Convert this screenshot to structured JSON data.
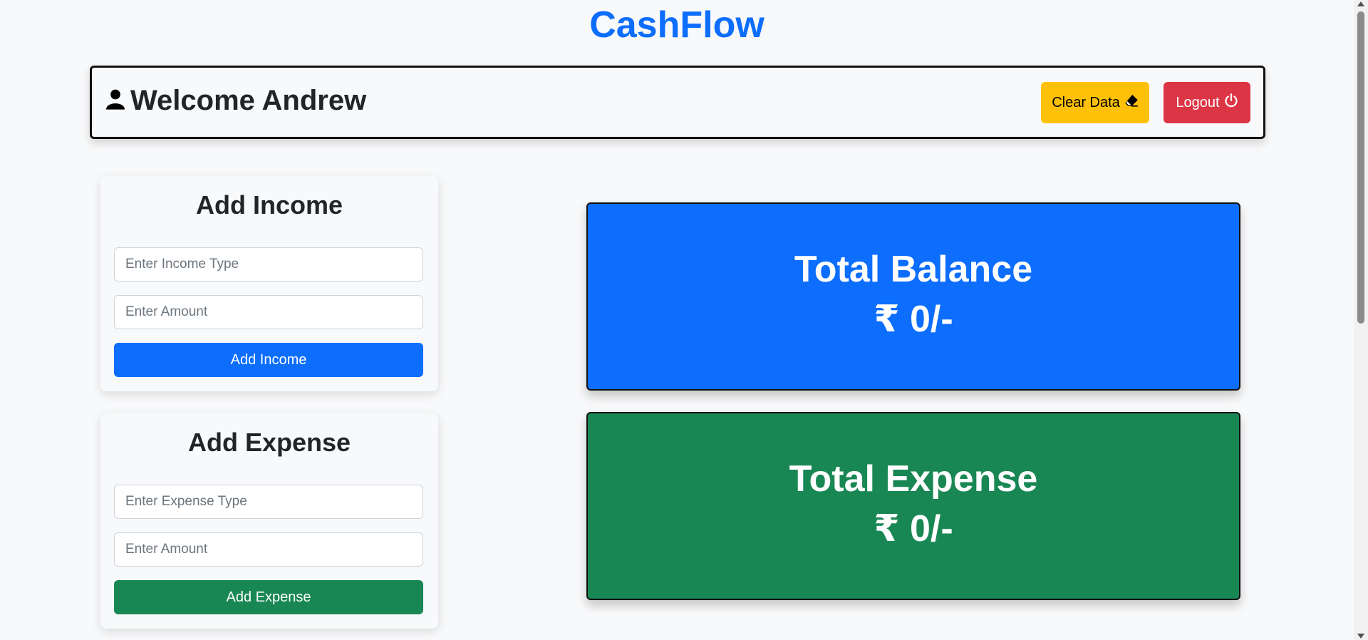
{
  "app": {
    "title": "CashFlow"
  },
  "header": {
    "welcome_text": "Welcome Andrew",
    "user_icon": "person-icon",
    "clear_label": "Clear Data",
    "clear_icon": "eraser-icon",
    "logout_label": "Logout",
    "logout_icon": "power-icon"
  },
  "income_form": {
    "title": "Add Income",
    "type_placeholder": "Enter Income Type",
    "amount_placeholder": "Enter Amount",
    "submit_label": "Add Income"
  },
  "expense_form": {
    "title": "Add Expense",
    "type_placeholder": "Enter Expense Type",
    "amount_placeholder": "Enter Amount",
    "submit_label": "Add Expense"
  },
  "stats": {
    "balance_label": "Total Balance",
    "balance_value": "₹ 0/-",
    "expense_label": "Total Expense",
    "expense_value": "₹ 0/-"
  },
  "colors": {
    "primary": "#0d6efd",
    "success": "#198754",
    "warning": "#ffc107",
    "danger": "#dc3545"
  }
}
